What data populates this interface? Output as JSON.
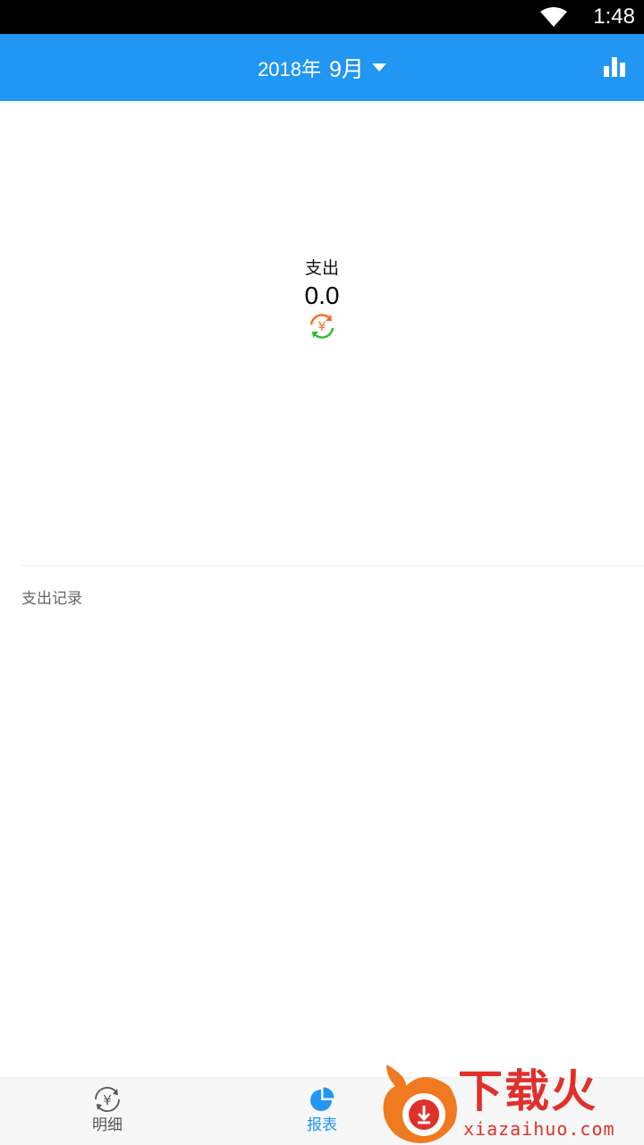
{
  "status_bar": {
    "time": "1:48",
    "wifi_icon": "wifi-icon"
  },
  "header": {
    "year": "2018年",
    "month": "9月",
    "dropdown_icon": "caret-down-icon",
    "chart_icon": "bar-chart-icon",
    "background_color": "#2196F3"
  },
  "summary": {
    "label": "支出",
    "amount": "0.0",
    "swap_icon": "currency-swap-icon"
  },
  "records": {
    "title": "支出记录"
  },
  "bottom_nav": {
    "tabs": [
      {
        "label": "明细",
        "icon": "yuan-circle-icon",
        "active": false
      },
      {
        "label": "报表",
        "icon": "pie-chart-icon",
        "active": true
      }
    ],
    "active_color": "#2196F3"
  },
  "watermark": {
    "brand_cn": "下载火",
    "brand_url": "xiazaihuo.com"
  }
}
